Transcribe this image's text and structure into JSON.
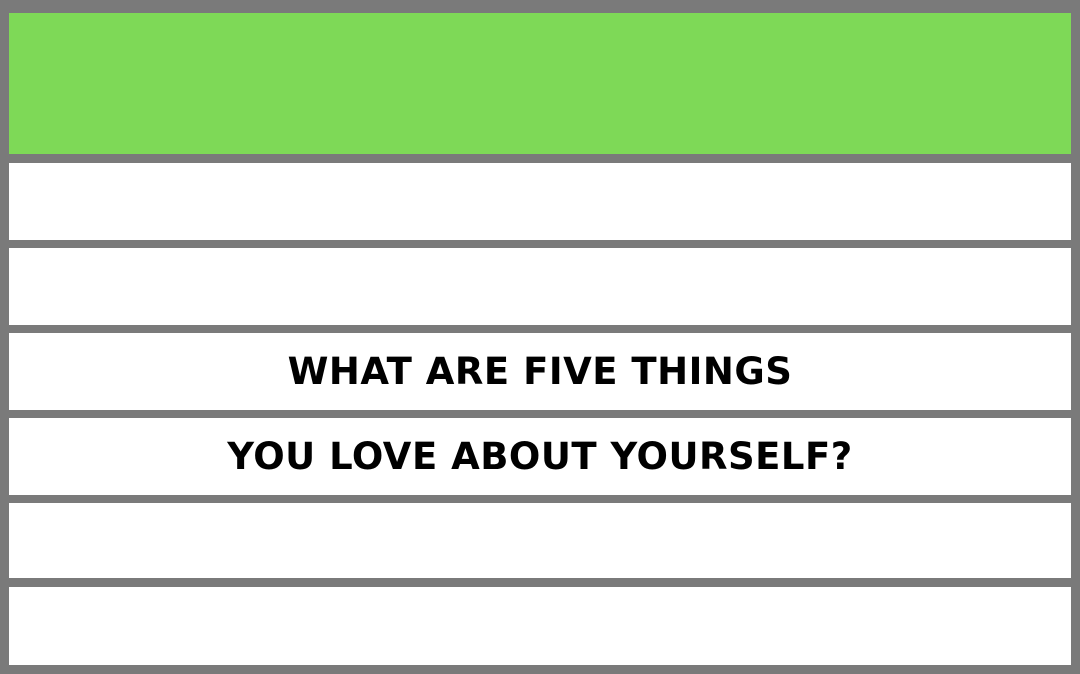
{
  "colors": {
    "border": "#7a7a7a",
    "header": "#7ed957",
    "row": "#ffffff",
    "text": "#000000"
  },
  "question": {
    "line1": "WHAT ARE FIVE THINGS",
    "line2": "YOU LOVE ABOUT YOURSELF?"
  }
}
